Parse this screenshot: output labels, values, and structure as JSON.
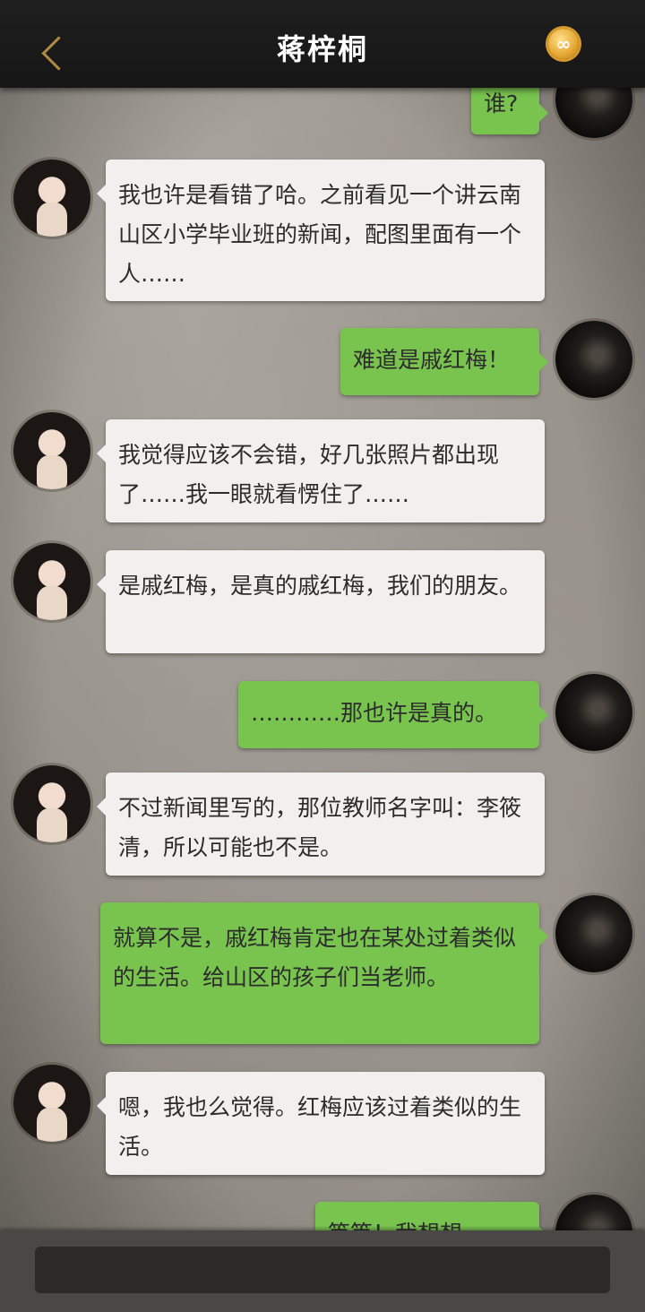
{
  "header": {
    "back_label": "",
    "title": "蒋梓桐",
    "badge_symbol": "∞"
  },
  "messages": [
    {
      "side": "right",
      "text": "谁?"
    },
    {
      "side": "left",
      "text": "我也许是看错了哈。之前看见一个讲云南山区小学毕业班的新闻，配图里面有一个人……"
    },
    {
      "side": "right",
      "text": "难道是戚红梅！"
    },
    {
      "side": "left",
      "text": "我觉得应该不会错，好几张照片都出现了……我一眼就看愣住了……"
    },
    {
      "side": "left",
      "text": "是戚红梅，是真的戚红梅，我们的朋友。"
    },
    {
      "side": "right",
      "text": "…………那也许是真的。"
    },
    {
      "side": "left",
      "text": "不过新闻里写的，那位教师名字叫：李筱清，所以可能也不是。"
    },
    {
      "side": "right",
      "text": "就算不是，戚红梅肯定也在某处过着类似的生活。给山区的孩子们当老师。"
    },
    {
      "side": "left",
      "text": "嗯，我也么觉得。红梅应该过着类似的生活。"
    },
    {
      "side": "right",
      "text": "等等！我想想"
    }
  ],
  "colors": {
    "header_bg": "#1a1a1a",
    "accent_gold": "#b08a42",
    "bubble_left": "#f1f0ee",
    "bubble_right": "#79c34f"
  }
}
